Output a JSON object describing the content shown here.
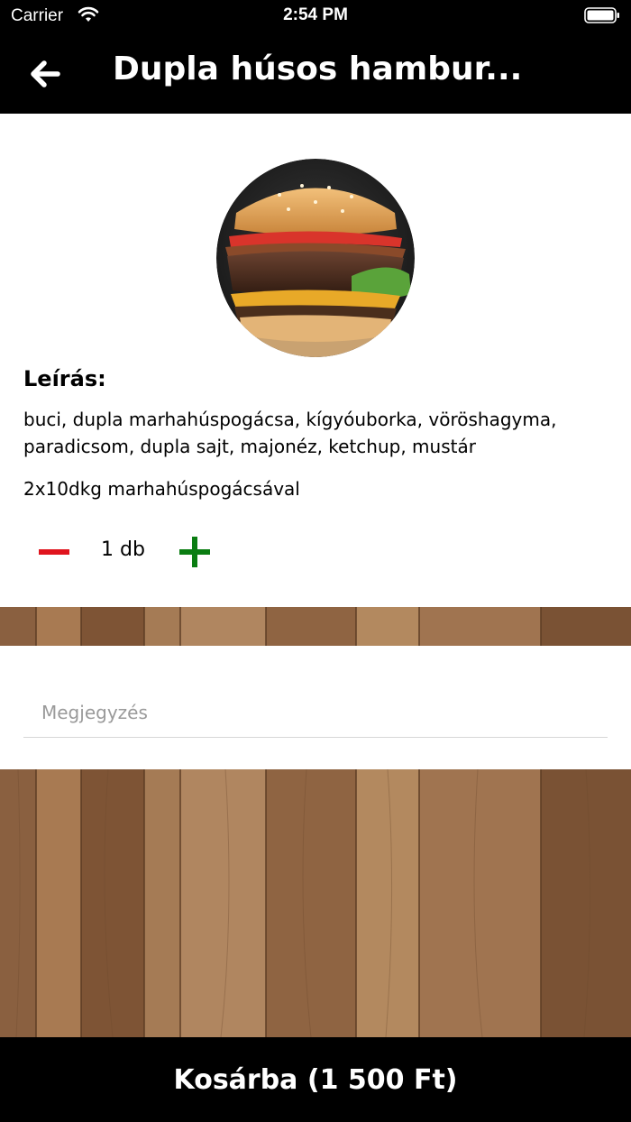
{
  "status_bar": {
    "carrier": "Carrier",
    "time": "2:54 PM"
  },
  "nav": {
    "title": "Dupla húsos hambur...",
    "back_icon": "arrow-left-icon"
  },
  "product": {
    "image_icon": "burger-photo",
    "description_heading": "Leírás:",
    "description": "buci, dupla marhahúspogácsa, kígyóuborka, vöröshagyma, paradicsom, dupla sajt, majonéz, ketchup, mustár",
    "extra": "2x10dkg marhahúspogácsával"
  },
  "quantity": {
    "value": "1 db",
    "minus_color": "#e0141e",
    "plus_color": "#0a7d12"
  },
  "note": {
    "placeholder": "Megjegyzés"
  },
  "cart": {
    "label": "Kosárba (1 500 Ft)"
  },
  "colors": {
    "bar_background": "#000000",
    "wood": "#9a6e47"
  }
}
